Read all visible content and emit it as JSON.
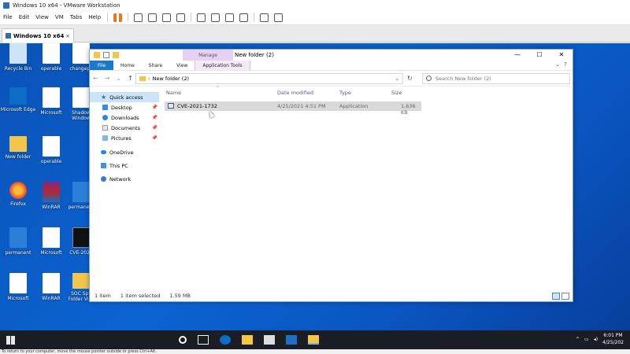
{
  "vmware": {
    "title": "Windows 10 x64 - VMware Workstation",
    "menu": [
      "File",
      "Edit",
      "View",
      "VM",
      "Tabs",
      "Help"
    ],
    "tab_label": "Windows 10 x64",
    "tab_close": "×",
    "status_hint": "To return to your computer, move the mouse pointer outside or press Ctrl+Alt."
  },
  "desktop_icons": [
    {
      "label": "Recycle Bin",
      "kind": "recycle"
    },
    {
      "label": "operable",
      "kind": "file"
    },
    {
      "label": "changepk",
      "kind": "file"
    },
    {
      "label": "Microsoft Edge",
      "kind": "edge"
    },
    {
      "label": "Microsoft",
      "kind": "file"
    },
    {
      "label": "Shadow Window",
      "kind": "file"
    },
    {
      "label": "New folder",
      "kind": "folder"
    },
    {
      "label": "operable",
      "kind": "file"
    },
    {
      "label": "Firefox",
      "kind": "firefox"
    },
    {
      "label": "WinRAR",
      "kind": "winrar"
    },
    {
      "label": "permanent",
      "kind": "pin"
    },
    {
      "label": "permanent",
      "kind": "pin"
    },
    {
      "label": "Microsoft",
      "kind": "file"
    },
    {
      "label": "CVE-2021",
      "kind": "dark"
    },
    {
      "label": "Microsoft",
      "kind": "file"
    },
    {
      "label": "WinRAR",
      "kind": "file"
    },
    {
      "label": "SOC Spy Folder Visit",
      "kind": "folder"
    }
  ],
  "explorer": {
    "window_title": "New folder (2)",
    "context_tab": "Manage",
    "window_controls": {
      "minimize": "—",
      "maximize": "☐",
      "close": "✕"
    },
    "ribbon_tabs": [
      "File",
      "Home",
      "Share",
      "View",
      "Application Tools"
    ],
    "ribbon_controls": {
      "collapse": "⌄",
      "help": "?"
    },
    "nav": {
      "back": "←",
      "forward": "→",
      "recent": "⌄",
      "up": "↑"
    },
    "address_path": "New folder (2)",
    "search_placeholder": "Search New folder (2)",
    "nav_pane": [
      {
        "label": "Quick access",
        "pinned": false,
        "selected": true
      },
      {
        "label": "Desktop",
        "pinned": true
      },
      {
        "label": "Downloads",
        "pinned": true
      },
      {
        "label": "Documents",
        "pinned": true
      },
      {
        "label": "Pictures",
        "pinned": true
      },
      {
        "label": "OneDrive"
      },
      {
        "label": "This PC"
      },
      {
        "label": "Network"
      }
    ],
    "columns": [
      "Name",
      "Date modified",
      "Type",
      "Size"
    ],
    "files": [
      {
        "name": "CVE-2021-1732",
        "date": "4/25/2021 4:51 PM",
        "type": "Application",
        "size": "1,636 KB"
      }
    ],
    "status": {
      "items": "1 item",
      "selected": "1 item selected",
      "size": "1.59 MB"
    }
  },
  "taskbar": {
    "clock_time": "6:01 PM",
    "clock_date": "4/25/202"
  }
}
